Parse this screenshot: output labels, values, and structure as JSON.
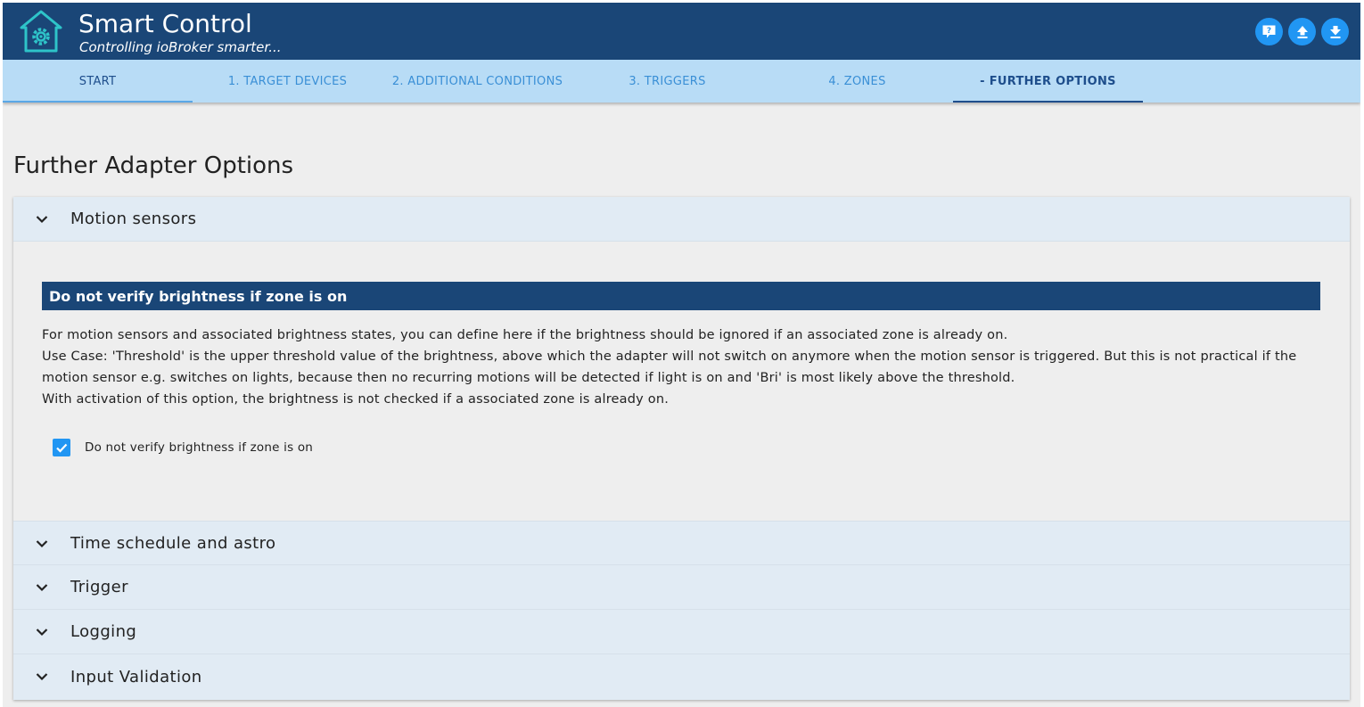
{
  "header": {
    "title": "Smart Control",
    "subtitle": "Controlling ioBroker smarter...",
    "logo_icon": "house-gear-icon",
    "buttons": [
      {
        "icon": "help-icon"
      },
      {
        "icon": "upload-icon"
      },
      {
        "icon": "download-icon"
      }
    ]
  },
  "tabs": [
    {
      "label": "START"
    },
    {
      "label": "1. TARGET DEVICES"
    },
    {
      "label": "2. ADDITIONAL CONDITIONS"
    },
    {
      "label": "3. TRIGGERS"
    },
    {
      "label": "4. ZONES"
    },
    {
      "label": "- FURTHER OPTIONS",
      "active": true
    }
  ],
  "page": {
    "title": "Further Adapter Options"
  },
  "accordion": {
    "sections": [
      {
        "label": "Motion sensors",
        "expanded": true
      },
      {
        "label": "Time schedule and astro"
      },
      {
        "label": "Trigger"
      },
      {
        "label": "Logging"
      },
      {
        "label": "Input Validation"
      }
    ],
    "motion": {
      "section_heading": "Do not verify brightness if zone is on",
      "description": [
        "For motion sensors and associated brightness states, you can define here if the brightness should be ignored if an associated zone is already on.",
        "Use Case: 'Threshold' is the upper threshold value of the brightness, above which the adapter will not switch on anymore when the motion sensor is triggered. But this is not practical if the motion sensor e.g. switches on lights, because then no recurring motions will be detected if light is on and 'Bri' is most likely above the threshold.",
        "With activation of this option, the brightness is not checked if a associated zone is already on."
      ],
      "checkbox_label": "Do not verify brightness if zone is on",
      "checkbox_checked": true
    }
  },
  "colors": {
    "header_bg": "#1a4677",
    "tabs_bg": "#b8dcf6",
    "accent": "#2196f3",
    "accordion_head_bg": "#e1ebf4"
  }
}
